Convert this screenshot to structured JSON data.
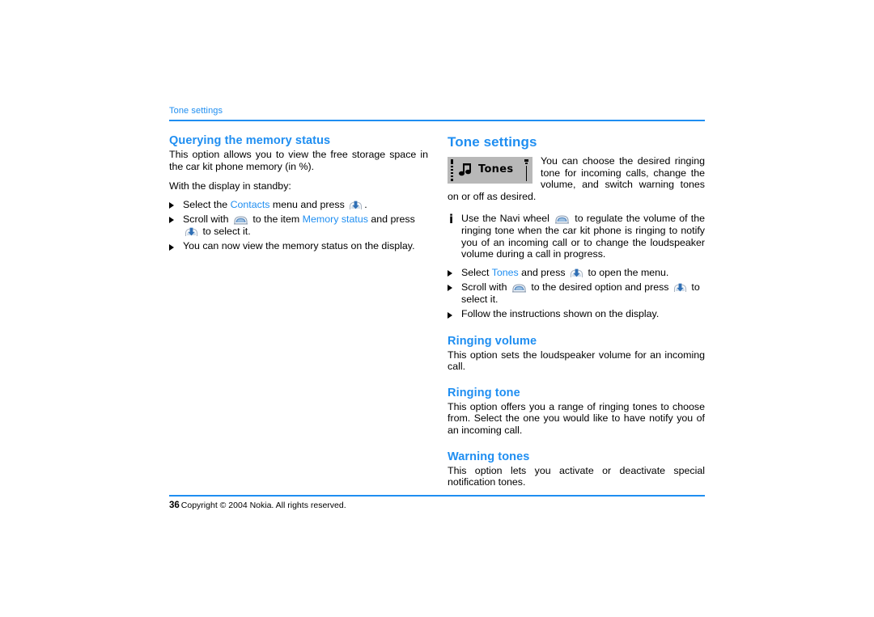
{
  "colors": {
    "accent": "#1f8ef1",
    "text": "#000000",
    "lcd_bg": "#b8b8b8",
    "page_bg": "#ffffff"
  },
  "header": {
    "running_head": "Tone settings"
  },
  "left_column": {
    "heading": "Querying the memory status",
    "paragraph_1_a": "This option allows you to view the free storage space in the car kit phone memory (in %).",
    "paragraph_2": "With the display in standby:",
    "bullets": [
      {
        "parts": [
          {
            "type": "text",
            "value": "Select the "
          },
          {
            "type": "link",
            "value": "Contacts"
          },
          {
            "type": "text",
            "value": " menu and press "
          },
          {
            "type": "icon",
            "value": "press-navi-wheel-icon"
          },
          {
            "type": "text",
            "value": "."
          }
        ]
      },
      {
        "parts": [
          {
            "type": "text",
            "value": "Scroll with "
          },
          {
            "type": "icon",
            "value": "navi-wheel-icon"
          },
          {
            "type": "text",
            "value": " to the item "
          },
          {
            "type": "link",
            "value": "Memory status"
          },
          {
            "type": "text",
            "value": " and press "
          },
          {
            "type": "icon",
            "value": "press-navi-wheel-icon"
          },
          {
            "type": "text",
            "value": " to select it."
          }
        ]
      },
      {
        "parts": [
          {
            "type": "text",
            "value": "You can now view the memory status on the display."
          }
        ]
      }
    ]
  },
  "right_column": {
    "heading": "Tone settings",
    "lcd": {
      "label": "Tones",
      "icon": "music-note-icon"
    },
    "intro": "You can choose the desired ringing tone for incoming calls, change the volume, and switch warning tones on or off as desired.",
    "note": {
      "marker": "i",
      "parts": [
        {
          "type": "text",
          "value": "Use the Navi wheel "
        },
        {
          "type": "icon",
          "value": "navi-wheel-icon"
        },
        {
          "type": "text",
          "value": " to regulate the volume of the ringing tone when the car kit phone is ringing to notify you of an incoming call or to change the loudspeaker volume during a call in progress."
        }
      ]
    },
    "bullets": [
      {
        "parts": [
          {
            "type": "text",
            "value": "Select "
          },
          {
            "type": "link",
            "value": "Tones"
          },
          {
            "type": "text",
            "value": " and press "
          },
          {
            "type": "icon",
            "value": "press-navi-wheel-icon"
          },
          {
            "type": "text",
            "value": " to open the menu."
          }
        ]
      },
      {
        "parts": [
          {
            "type": "text",
            "value": "Scroll with "
          },
          {
            "type": "icon",
            "value": "navi-wheel-icon"
          },
          {
            "type": "text",
            "value": " to the desired option and press "
          },
          {
            "type": "icon",
            "value": "press-navi-wheel-icon"
          },
          {
            "type": "text",
            "value": " to select it."
          }
        ]
      },
      {
        "parts": [
          {
            "type": "text",
            "value": "Follow the instructions shown on the display."
          }
        ]
      }
    ],
    "subsections": [
      {
        "heading": "Ringing volume",
        "body": "This option sets the loudspeaker volume for an incoming call."
      },
      {
        "heading": "Ringing tone",
        "body": "This option offers you a range of ringing tones to choose from. Select the one you would like to have notify you of an incoming call."
      },
      {
        "heading": "Warning tones",
        "body": "This option lets you activate or deactivate special notification tones."
      }
    ]
  },
  "footer": {
    "page_number": "36",
    "copyright": "Copyright © 2004 Nokia. All rights reserved."
  }
}
